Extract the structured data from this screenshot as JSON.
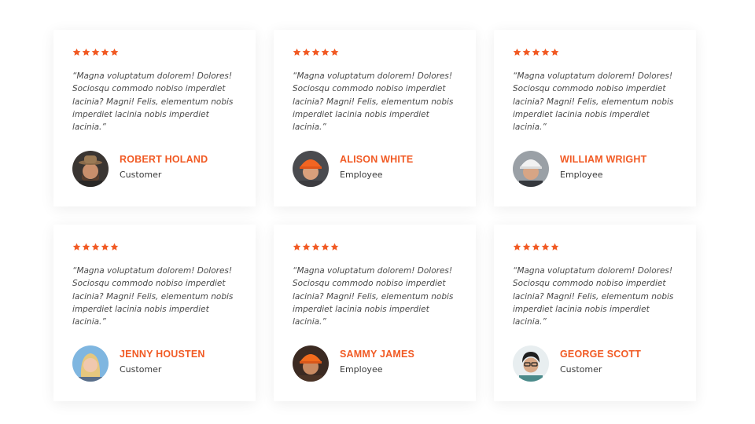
{
  "colors": {
    "accent": "#f15a24",
    "star": "#f15a24",
    "text": "#4a4a4a",
    "card_bg": "#ffffff"
  },
  "testimonials": [
    {
      "rating": 5,
      "quote": "“Magna voluptatum dolorem! Dolores! Sociosqu commodo nobiso imperdiet lacinia? Magni! Felis, elementum nobis imperdiet lacinia nobis imperdiet lacinia.”",
      "name": "ROBERT HOLAND",
      "role": "Customer",
      "avatar": "man-with-hat-avatar"
    },
    {
      "rating": 5,
      "quote": "“Magna voluptatum dolorem! Dolores! Sociosqu commodo nobiso imperdiet lacinia? Magni! Felis, elementum nobis imperdiet lacinia nobis imperdiet lacinia.”",
      "name": "ALISON WHITE",
      "role": "Employee",
      "avatar": "woman-orange-hardhat-avatar"
    },
    {
      "rating": 5,
      "quote": "“Magna voluptatum dolorem! Dolores! Sociosqu commodo nobiso imperdiet lacinia? Magni! Felis, elementum nobis imperdiet lacinia nobis imperdiet lacinia.”",
      "name": "WILLIAM WRIGHT",
      "role": "Employee",
      "avatar": "man-white-hardhat-avatar"
    },
    {
      "rating": 5,
      "quote": "“Magna voluptatum dolorem! Dolores! Sociosqu commodo nobiso imperdiet lacinia? Magni! Felis, elementum nobis imperdiet lacinia nobis imperdiet lacinia.”",
      "name": "JENNY HOUSTEN",
      "role": "Customer",
      "avatar": "woman-blonde-avatar"
    },
    {
      "rating": 5,
      "quote": "“Magna voluptatum dolorem! Dolores! Sociosqu commodo nobiso imperdiet lacinia? Magni! Felis, elementum nobis imperdiet lacinia nobis imperdiet lacinia.”",
      "name": "SAMMY JAMES",
      "role": "Employee",
      "avatar": "man-orange-hardhat-avatar"
    },
    {
      "rating": 5,
      "quote": "“Magna voluptatum dolorem! Dolores! Sociosqu commodo nobiso imperdiet lacinia? Magni! Felis, elementum nobis imperdiet lacinia nobis imperdiet lacinia.”",
      "name": "GEORGE SCOTT",
      "role": "Customer",
      "avatar": "man-glasses-avatar"
    }
  ]
}
